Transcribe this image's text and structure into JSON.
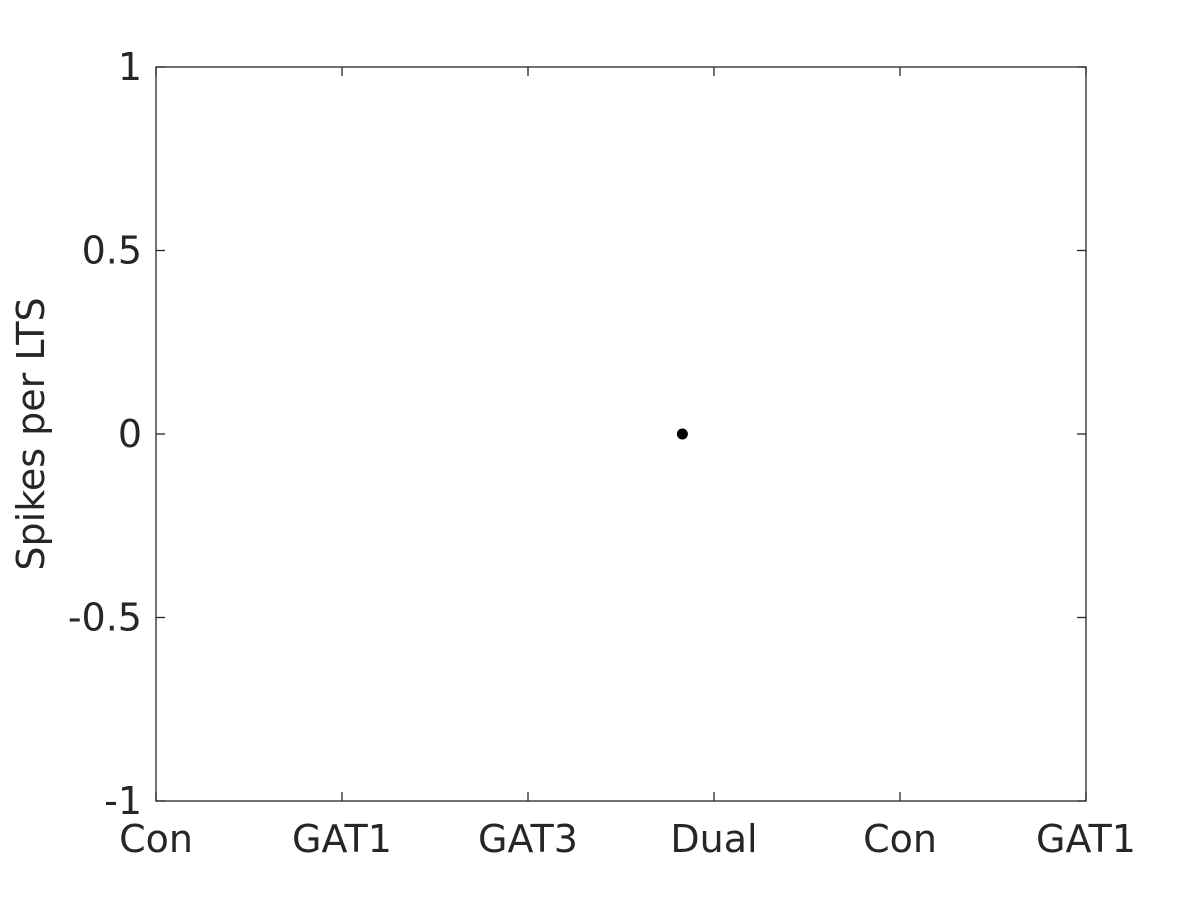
{
  "chart_data": {
    "type": "scatter",
    "title": "",
    "xlabel": "",
    "ylabel": "Spikes per LTS",
    "x_tick_positions": [
      1,
      2,
      3,
      4,
      5,
      6
    ],
    "x_tick_labels": [
      "Con",
      "GAT1",
      "GAT3",
      "Dual",
      "Con",
      "GAT1"
    ],
    "y_ticks": [
      -1,
      -0.5,
      0,
      0.5,
      1
    ],
    "y_tick_labels": [
      "-1",
      "-0.5",
      "0",
      "0.5",
      "1"
    ],
    "xlim": [
      1,
      6
    ],
    "ylim": [
      -1,
      1
    ],
    "grid": false,
    "box": true,
    "series": [
      {
        "name": "data",
        "color": "#000000",
        "points": [
          {
            "x": 3.83,
            "y": 0
          }
        ]
      }
    ],
    "axis_color": "#262626"
  }
}
